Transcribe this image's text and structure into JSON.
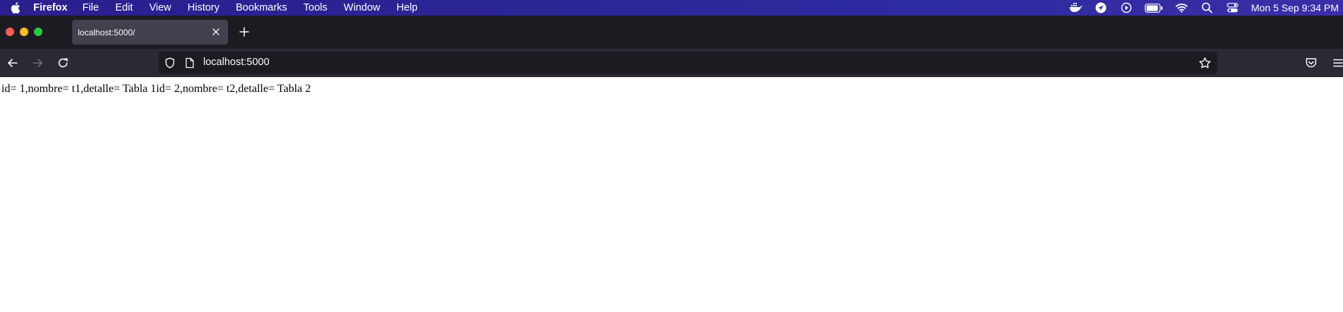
{
  "menubar": {
    "app_name": "Firefox",
    "items": [
      "File",
      "Edit",
      "View",
      "History",
      "Bookmarks",
      "Tools",
      "Window",
      "Help"
    ],
    "clock": "Mon 5 Sep  9:34 PM",
    "status_icons": [
      "docker-icon",
      "location-icon",
      "play-icon",
      "battery-icon",
      "wifi-icon",
      "spotlight-icon",
      "control-center-icon"
    ]
  },
  "tabs": [
    {
      "title": "localhost:5000/"
    }
  ],
  "toolbar": {
    "url": "localhost:5000"
  },
  "page": {
    "text": "id= 1,nombre= t1,detalle= Tabla 1id= 2,nombre= t2,detalle= Tabla 2"
  },
  "colors": {
    "menubar": "#2b2596",
    "tabstrip": "#1c1b22",
    "active_tab": "#42414d",
    "navbar": "#2b2a33",
    "urlbar": "#1c1b22"
  }
}
